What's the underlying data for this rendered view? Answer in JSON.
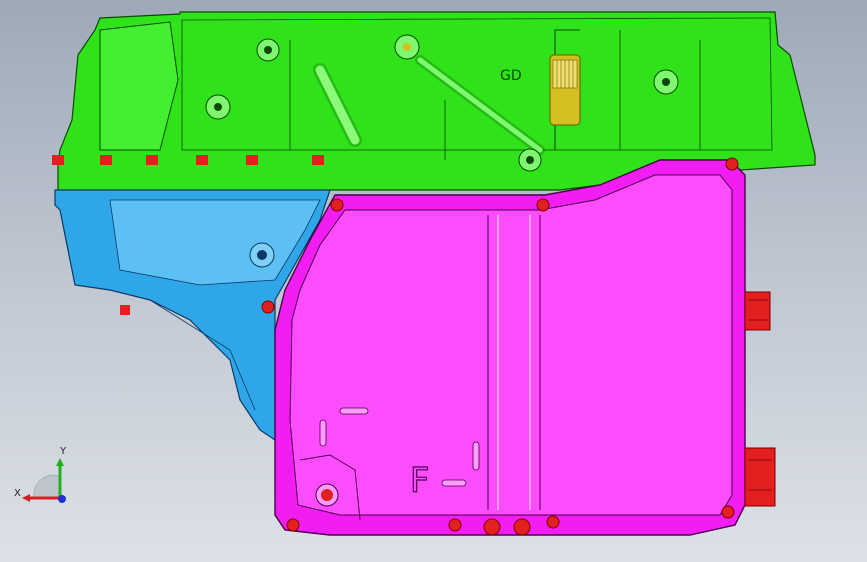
{
  "viewport": {
    "background_top": "#9ea9b8",
    "background_bottom": "#dde1e7"
  },
  "parts": {
    "upper_housing": {
      "color": "#2fe21a",
      "outline": "#0a4a00"
    },
    "lower_housing": {
      "color": "#2fa6e8",
      "outline": "#0a3a66"
    },
    "oil_pan": {
      "color": "#f21df2",
      "outline": "#4a004a"
    },
    "bolts": {
      "color": "#e22020"
    },
    "fitting": {
      "color": "#d4c020"
    }
  },
  "pan_marking": "F",
  "housing_marking": "GD",
  "triad": {
    "x_label": "X",
    "y_label": "Y",
    "x_color": "#d42020",
    "y_color": "#22b022",
    "z_color": "#2030d0"
  }
}
